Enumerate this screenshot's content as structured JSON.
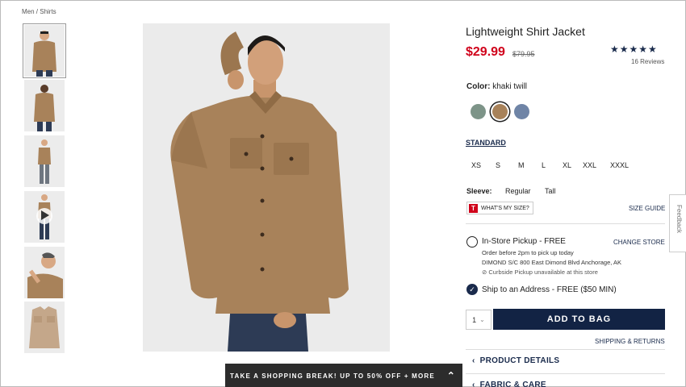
{
  "breadcrumb": "Men / Shirts",
  "product": {
    "title": "Lightweight Shirt Jacket",
    "price": "$29.99",
    "original_price": "$79.95",
    "rating_stars": "★★★★★",
    "rating_value": 4.5,
    "reviews": "16 Reviews"
  },
  "color": {
    "label": "Color:",
    "selected": "khaki twill",
    "swatches": [
      {
        "name": "sage",
        "hex": "#7d9488"
      },
      {
        "name": "khaki twill",
        "hex": "#a8825a"
      },
      {
        "name": "blue",
        "hex": "#6f84a6"
      }
    ]
  },
  "size": {
    "fit_tab": "STANDARD",
    "options": [
      "XS",
      "S",
      "M",
      "L",
      "XL",
      "XXL",
      "XXXL"
    ]
  },
  "sleeve": {
    "label": "Sleeve:",
    "options": [
      "Regular",
      "Tall"
    ]
  },
  "whats_my_size": {
    "badge": "T",
    "label": "WHAT'S MY SIZE?"
  },
  "size_guide": "SIZE GUIDE",
  "pickup": {
    "title": "In-Store Pickup - FREE",
    "change": "CHANGE STORE",
    "line1": "Order before 2pm to pick up today",
    "line2": "DIMOND S/C 800 East Dimond Blvd  Anchorage, AK",
    "line3": "⊘ Curbside Pickup unavailable at this store"
  },
  "ship": {
    "title": "Ship to an Address - FREE ($50 MIN)",
    "check": "✓"
  },
  "quantity": {
    "value": "1",
    "chevron": "⌄"
  },
  "add_to_bag": "ADD TO BAG",
  "shipping_returns": "SHIPPING & RETURNS",
  "accordions": [
    "PRODUCT DETAILS",
    "FABRIC & CARE"
  ],
  "feedback": "Feedback",
  "promo": {
    "text": "TAKE A SHOPPING BREAK! UP TO 50% OFF + MORE",
    "caret": "⌃"
  },
  "colors": {
    "accent": "#1a2b4c",
    "sale": "#d0021b",
    "shirt": "#a8825a"
  },
  "icons": {
    "play": "play-icon",
    "chevron": "chevron-left-icon"
  }
}
